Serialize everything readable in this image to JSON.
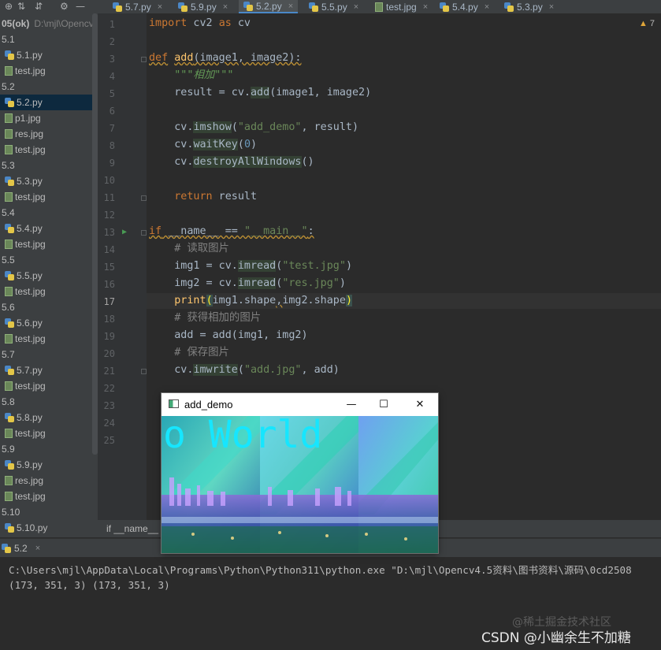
{
  "tabs": [
    {
      "label": "5.7.py",
      "kind": "py",
      "active": false
    },
    {
      "label": "5.9.py",
      "kind": "py",
      "active": false
    },
    {
      "label": "5.2.py",
      "kind": "py",
      "active": true
    },
    {
      "label": "5.5.py",
      "kind": "py",
      "active": false
    },
    {
      "label": "test.jpg",
      "kind": "img",
      "active": false
    },
    {
      "label": "5.4.py",
      "kind": "py",
      "active": false
    },
    {
      "label": "5.3.py",
      "kind": "py",
      "active": false
    }
  ],
  "tab_close_glyph": "×",
  "tree": {
    "root_name": "05(ok)",
    "root_path": "D:\\mjl\\Opencv",
    "items": [
      {
        "label": "5.1",
        "type": "folder"
      },
      {
        "label": "5.1.py",
        "type": "py"
      },
      {
        "label": "test.jpg",
        "type": "img"
      },
      {
        "label": "5.2",
        "type": "folder"
      },
      {
        "label": "5.2.py",
        "type": "py",
        "selected": true
      },
      {
        "label": "p1.jpg",
        "type": "img"
      },
      {
        "label": "res.jpg",
        "type": "img"
      },
      {
        "label": "test.jpg",
        "type": "img"
      },
      {
        "label": "5.3",
        "type": "folder"
      },
      {
        "label": "5.3.py",
        "type": "py"
      },
      {
        "label": "test.jpg",
        "type": "img"
      },
      {
        "label": "5.4",
        "type": "folder"
      },
      {
        "label": "5.4.py",
        "type": "py"
      },
      {
        "label": "test.jpg",
        "type": "img"
      },
      {
        "label": "5.5",
        "type": "folder"
      },
      {
        "label": "5.5.py",
        "type": "py"
      },
      {
        "label": "test.jpg",
        "type": "img"
      },
      {
        "label": "5.6",
        "type": "folder"
      },
      {
        "label": "5.6.py",
        "type": "py"
      },
      {
        "label": "test.jpg",
        "type": "img"
      },
      {
        "label": "5.7",
        "type": "folder"
      },
      {
        "label": "5.7.py",
        "type": "py"
      },
      {
        "label": "test.jpg",
        "type": "img"
      },
      {
        "label": "5.8",
        "type": "folder"
      },
      {
        "label": "5.8.py",
        "type": "py"
      },
      {
        "label": "test.jpg",
        "type": "img"
      },
      {
        "label": "5.9",
        "type": "folder"
      },
      {
        "label": "5.9.py",
        "type": "py"
      },
      {
        "label": "res.jpg",
        "type": "img"
      },
      {
        "label": "test.jpg",
        "type": "img"
      },
      {
        "label": "5.10",
        "type": "folder"
      },
      {
        "label": "5.10.py",
        "type": "py"
      }
    ]
  },
  "editor": {
    "current_line": 17,
    "run_line": 13,
    "warning_count": "7",
    "line_numbers": [
      "1",
      "2",
      "3",
      "4",
      "5",
      "6",
      "7",
      "8",
      "9",
      "10",
      "11",
      "12",
      "13",
      "14",
      "15",
      "16",
      "17",
      "18",
      "19",
      "20",
      "21",
      "22",
      "23",
      "24",
      "25"
    ],
    "lines": [
      [
        {
          "t": "import",
          "c": "kw"
        },
        {
          "t": " cv2 "
        },
        {
          "t": "as",
          "c": "kw"
        },
        {
          "t": " cv"
        }
      ],
      [],
      [
        {
          "t": "def",
          "c": "kw warnu"
        },
        {
          "t": " "
        },
        {
          "t": "add",
          "c": "fn warnu"
        },
        {
          "t": "(image1, image2):",
          "c": "warnu"
        }
      ],
      [
        {
          "t": "    "
        },
        {
          "t": "\"\"\"相加\"\"\"",
          "c": "doc"
        }
      ],
      [
        {
          "t": "    result = cv."
        },
        {
          "t": "add",
          "c": "hl"
        },
        {
          "t": "(image1, image2)"
        }
      ],
      [],
      [
        {
          "t": "    cv."
        },
        {
          "t": "imshow",
          "c": "hl"
        },
        {
          "t": "("
        },
        {
          "t": "\"add_demo\"",
          "c": "str"
        },
        {
          "t": ", result)"
        }
      ],
      [
        {
          "t": "    cv."
        },
        {
          "t": "waitKey",
          "c": "hl"
        },
        {
          "t": "("
        },
        {
          "t": "0",
          "c": "num"
        },
        {
          "t": ")"
        }
      ],
      [
        {
          "t": "    cv."
        },
        {
          "t": "destroyAllWindows",
          "c": "hl"
        },
        {
          "t": "()"
        }
      ],
      [],
      [
        {
          "t": "    "
        },
        {
          "t": "return",
          "c": "kw"
        },
        {
          "t": " result"
        }
      ],
      [],
      [
        {
          "t": "if",
          "c": "kw warnu"
        },
        {
          "t": " __name__ == ",
          "c": "warnu"
        },
        {
          "t": "\"__main__\"",
          "c": "str warnu"
        },
        {
          "t": ":",
          "c": "warnu"
        }
      ],
      [
        {
          "t": "    "
        },
        {
          "t": "# 读取图片",
          "c": "cmt"
        }
      ],
      [
        {
          "t": "    img1 = cv."
        },
        {
          "t": "imread",
          "c": "hl"
        },
        {
          "t": "("
        },
        {
          "t": "\"test.jpg\"",
          "c": "str"
        },
        {
          "t": ")"
        }
      ],
      [
        {
          "t": "    img2 = cv."
        },
        {
          "t": "imread",
          "c": "hl"
        },
        {
          "t": "("
        },
        {
          "t": "\"res.jpg\"",
          "c": "str"
        },
        {
          "t": ")"
        }
      ],
      [
        {
          "t": "    print",
          "c": "fn"
        },
        {
          "t": "(",
          "c": "paren"
        },
        {
          "t": "img1.shape"
        },
        {
          "t": ",",
          "c": "warnu"
        },
        {
          "t": "img2.shape"
        },
        {
          "t": ")",
          "c": "paren"
        }
      ],
      [
        {
          "t": "    "
        },
        {
          "t": "# 获得相加的图片",
          "c": "cmt"
        }
      ],
      [
        {
          "t": "    add = add(img1, img2)"
        }
      ],
      [
        {
          "t": "    "
        },
        {
          "t": "# 保存图片",
          "c": "cmt"
        }
      ],
      [
        {
          "t": "    cv."
        },
        {
          "t": "imwrite",
          "c": "hl"
        },
        {
          "t": "("
        },
        {
          "t": "\"add.jpg\"",
          "c": "str"
        },
        {
          "t": ", add)"
        }
      ],
      [],
      [],
      [],
      []
    ]
  },
  "breadcrumb": "if __name__ == '__main__'",
  "run": {
    "tab_label": "5.2",
    "output": [
      "C:\\Users\\mjl\\AppData\\Local\\Programs\\Python\\Python311\\python.exe \"D:\\mjl\\Opencv4.5资料\\图书资料\\源码\\0cd2508",
      "(173, 351, 3) (173, 351, 3)"
    ]
  },
  "cv_window": {
    "title": "add_demo",
    "overlay_text": "o World",
    "minimize": "—",
    "maximize": "☐",
    "close": "✕"
  },
  "watermark": {
    "line1": "@稀土掘金技术社区",
    "line2": "CSDN @小幽余生不加糖"
  }
}
